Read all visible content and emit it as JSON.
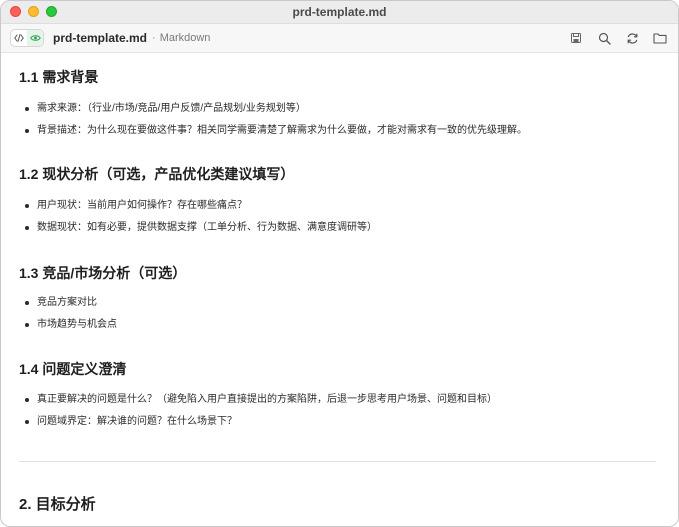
{
  "window": {
    "title": "prd-template.md"
  },
  "toolbar": {
    "filename": "prd-template.md",
    "separator": "·",
    "filetype": "Markdown",
    "mode_icons": [
      "code-icon",
      "eye-icon"
    ],
    "tool_icons": [
      "save-icon",
      "search-icon",
      "refresh-icon",
      "folder-icon"
    ]
  },
  "doc": {
    "sections": [
      {
        "heading": "1.1 需求背景",
        "items": [
          "需求来源：（行业/市场/竞品/用户反馈/产品规划/业务规划等）",
          "背景描述：为什么现在要做这件事？相关同学需要清楚了解需求为什么要做，才能对需求有一致的优先级理解。"
        ]
      },
      {
        "heading": "1.2 现状分析（可选，产品优化类建议填写）",
        "items": [
          "用户现状：当前用户如何操作？存在哪些痛点？",
          "数据现状：如有必要，提供数据支撑（工单分析、行为数据、满意度调研等）"
        ]
      },
      {
        "heading": "1.3 竞品/市场分析（可选）",
        "items": [
          "竞品方案对比",
          "市场趋势与机会点"
        ]
      },
      {
        "heading": "1.4 问题定义澄清",
        "items": [
          "真正要解决的问题是什么？（避免陷入用户直接提出的方案陷阱，后退一步思考用户场景、问题和目标）",
          "问题域界定：解决谁的问题？在什么场景下？"
        ]
      }
    ],
    "next_heading": "2. 目标分析"
  }
}
